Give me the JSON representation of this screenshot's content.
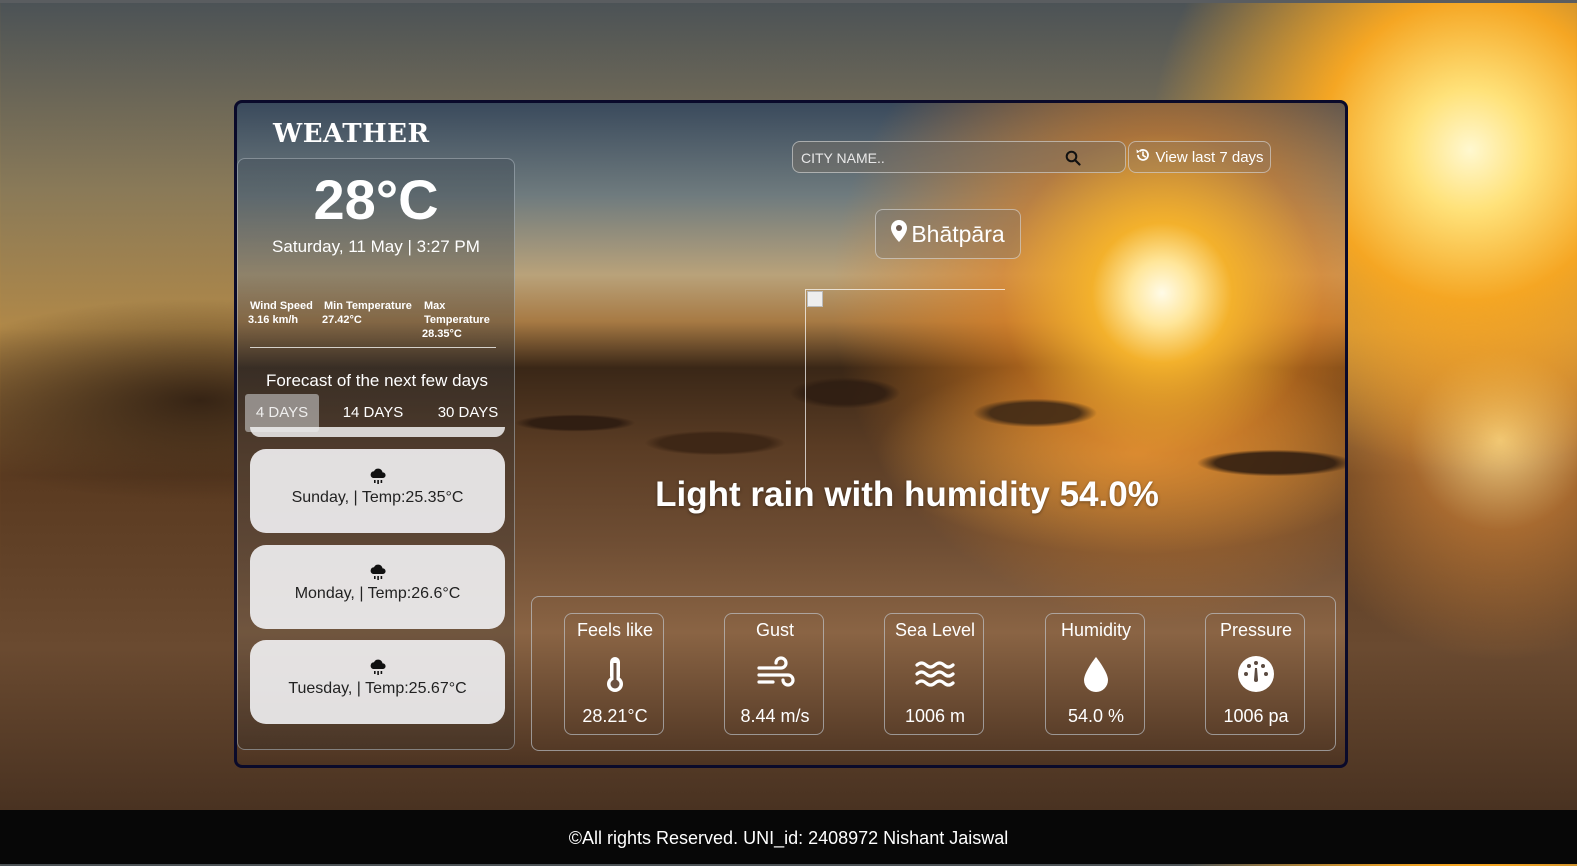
{
  "brand": "WEATHER",
  "current": {
    "temperature": "28°C",
    "datetime": "Saturday, 11 May | 3:27 PM",
    "stats": [
      {
        "label": "Wind Speed",
        "value": "3.16 km/h"
      },
      {
        "label": "Min Temperature",
        "value": "27.42°C"
      },
      {
        "label": "Max Temperature",
        "value": "28.35°C"
      }
    ]
  },
  "forecast": {
    "title": "Forecast of the next few days",
    "tabs": [
      {
        "label": "4 DAYS",
        "active": true
      },
      {
        "label": "14 DAYS",
        "active": false
      },
      {
        "label": "30 DAYS",
        "active": false
      }
    ],
    "days": [
      {
        "icon": "rain-cloud-icon",
        "text": "Sunday, | Temp:25.35°C"
      },
      {
        "icon": "rain-cloud-icon",
        "text": "Monday, | Temp:26.6°C"
      },
      {
        "icon": "rain-cloud-icon",
        "text": "Tuesday, | Temp:25.67°C"
      }
    ]
  },
  "search": {
    "placeholder": "CITY NAME..",
    "value": "",
    "icon": "search-icon"
  },
  "history_button": {
    "label": "View last 7 days",
    "icon": "history-icon"
  },
  "location": {
    "name": "Bhātpāra",
    "icon": "map-pin-icon"
  },
  "description": "Light rain with humidity 54.0%",
  "details": [
    {
      "label": "Feels like",
      "icon": "thermometer-icon",
      "value": "28.21°C"
    },
    {
      "label": "Gust",
      "icon": "wind-icon",
      "value": "8.44 m/s"
    },
    {
      "label": "Sea Level",
      "icon": "water-waves-icon",
      "value": "1006 m"
    },
    {
      "label": "Humidity",
      "icon": "droplet-icon",
      "value": "54.0 %"
    },
    {
      "label": "Pressure",
      "icon": "gauge-icon",
      "value": "1006 pa"
    }
  ],
  "footer": "©All rights Reserved. UNI_id: 2408972 Nishant Jaiswal"
}
